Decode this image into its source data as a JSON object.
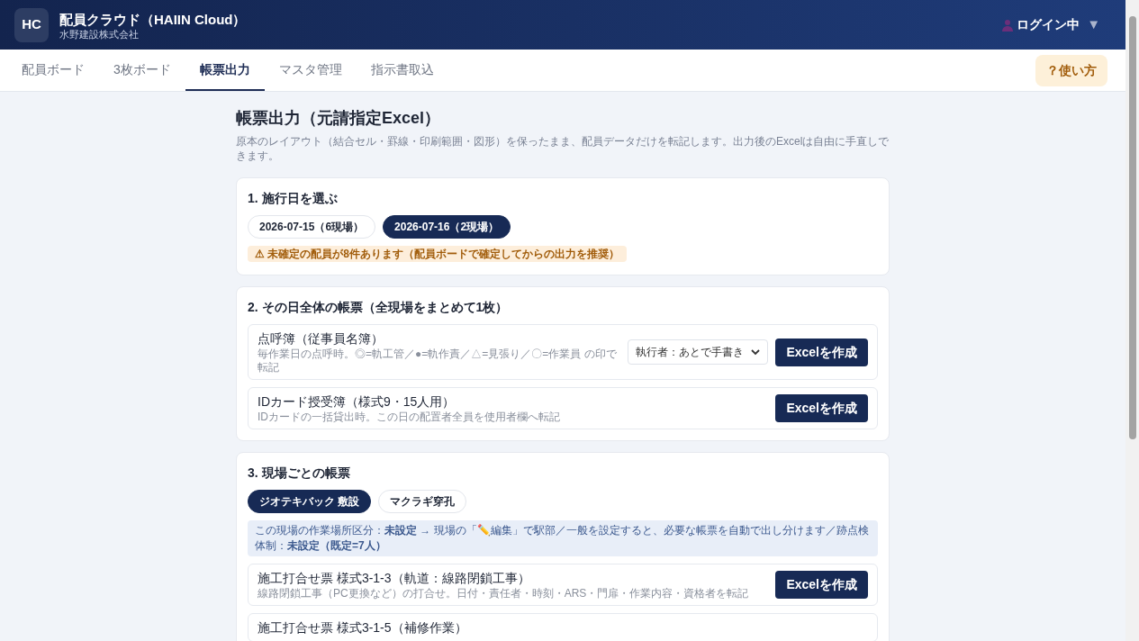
{
  "header": {
    "logo": "HC",
    "title": "配員クラウド（HAIIN Cloud）",
    "company": "水野建設株式会社",
    "user": "ログイン中",
    "caret": "▼"
  },
  "tabs": [
    {
      "label": "配員ボード",
      "selected": false
    },
    {
      "label": "3枚ボード",
      "selected": false
    },
    {
      "label": "帳票出力",
      "selected": true
    },
    {
      "label": "マスタ管理",
      "selected": false
    },
    {
      "label": "指示書取込",
      "selected": false
    }
  ],
  "help_button": "？使い方",
  "page": {
    "title": "帳票出力（元請指定Excel）",
    "description": "原本のレイアウト（結合セル・罫線・印刷範囲・図形）を保ったまま、配員データだけを転記します。出力後のExcelは自由に手直しできます。"
  },
  "section1": {
    "heading": "1. 施行日を選ぶ",
    "dates": [
      {
        "label": "2026-07-15（6現場）",
        "selected": false
      },
      {
        "label": "2026-07-16（2現場）",
        "selected": true
      }
    ],
    "warning": "⚠ 未確定の配員が8件あります（配員ボードで確定してからの出力を推奨）"
  },
  "section2": {
    "heading": "2. その日全体の帳票（全現場をまとめて1枚）",
    "forms": [
      {
        "title": "点呼簿（従事員名簿）",
        "note": "毎作業日の点呼時。◎=軌工管／●=軌作責／△=見張り／〇=作業員 の印で転記",
        "select": "執行者：あとで手書き",
        "button": "Excelを作成"
      },
      {
        "title": "IDカード授受簿（様式9・15人用）",
        "note": "IDカードの一括貸出時。この日の配置者全員を使用者欄へ転記",
        "button": "Excelを作成"
      }
    ]
  },
  "section3": {
    "heading": "3. 現場ごとの帳票",
    "sites": [
      {
        "label": "ジオテキバック 敷設",
        "selected": true
      },
      {
        "label": "マクラギ穿孔",
        "selected": false
      }
    ],
    "info": "この現場の作業場所区分：**未設定** → 現場の「✏️編集」で駅部／一般を設定すると、必要な帳票を自動で出し分けます／跡点検体制：**未設定（既定=7人）**",
    "forms": [
      {
        "title": "施工打合せ票 様式3-1-3（軌道：線路閉鎖工事）",
        "note": "線路閉鎖工事（PC更換など）の打合せ。日付・責任者・時刻・ARS・門扉・作業内容・資格者を転記",
        "button": "Excelを作成"
      },
      {
        "title": "施工打合せ票 様式3-1-5（補修作業）"
      }
    ]
  }
}
